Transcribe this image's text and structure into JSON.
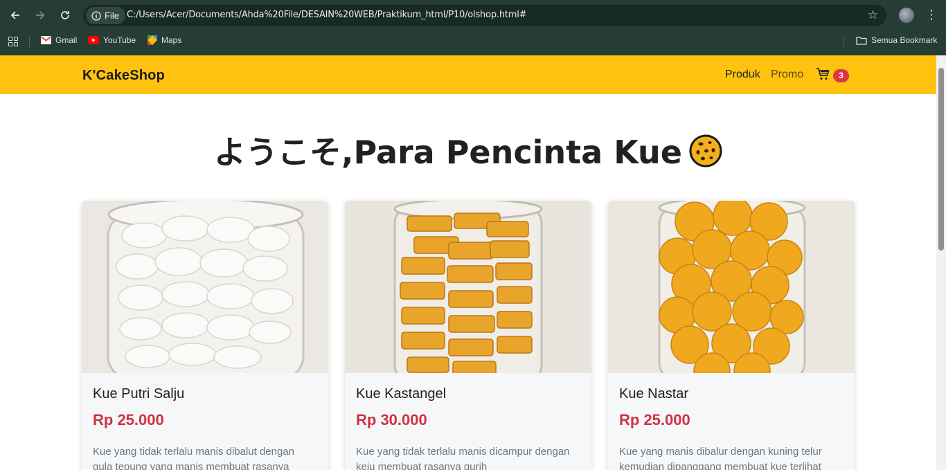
{
  "browser": {
    "site_chip": "File",
    "url": "C:/Users/Acer/Documents/Ahda%20File/DESAIN%20WEB/Praktikum_html/P10/olshop.html#",
    "bookmarks": [
      {
        "label": "Gmail",
        "icon": "gmail-icon"
      },
      {
        "label": "YouTube",
        "icon": "youtube-icon"
      },
      {
        "label": "Maps",
        "icon": "maps-icon"
      }
    ],
    "all_bookmarks": "Semua Bookmark"
  },
  "navbar": {
    "brand": "K'CakeShop",
    "links": [
      "Produk",
      "Promo"
    ],
    "cart_count": "3",
    "colors": {
      "bar": "#fec20f",
      "badge": "#dc3545"
    }
  },
  "hero": {
    "title": "ようこそ,Para Pencinta Kue"
  },
  "products": [
    {
      "name": "Kue Putri Salju",
      "price": "Rp 25.000",
      "description": "Kue yang tidak terlalu manis dibalut dengan gula tepung yang manis membuat rasanya",
      "image": "putri-salju-jar-image"
    },
    {
      "name": "Kue Kastangel",
      "price": "Rp 30.000",
      "description": "Kue yang tidak terlalu manis dicampur dengan keju membuat rasanya gurih",
      "image": "kastangel-jar-image"
    },
    {
      "name": "Kue Nastar",
      "price": "Rp 25.000",
      "description": "Kue yang manis dibalur dengan kuning telur kemudian dipanggang membuat kue terlihat",
      "image": "nastar-jar-image"
    }
  ]
}
